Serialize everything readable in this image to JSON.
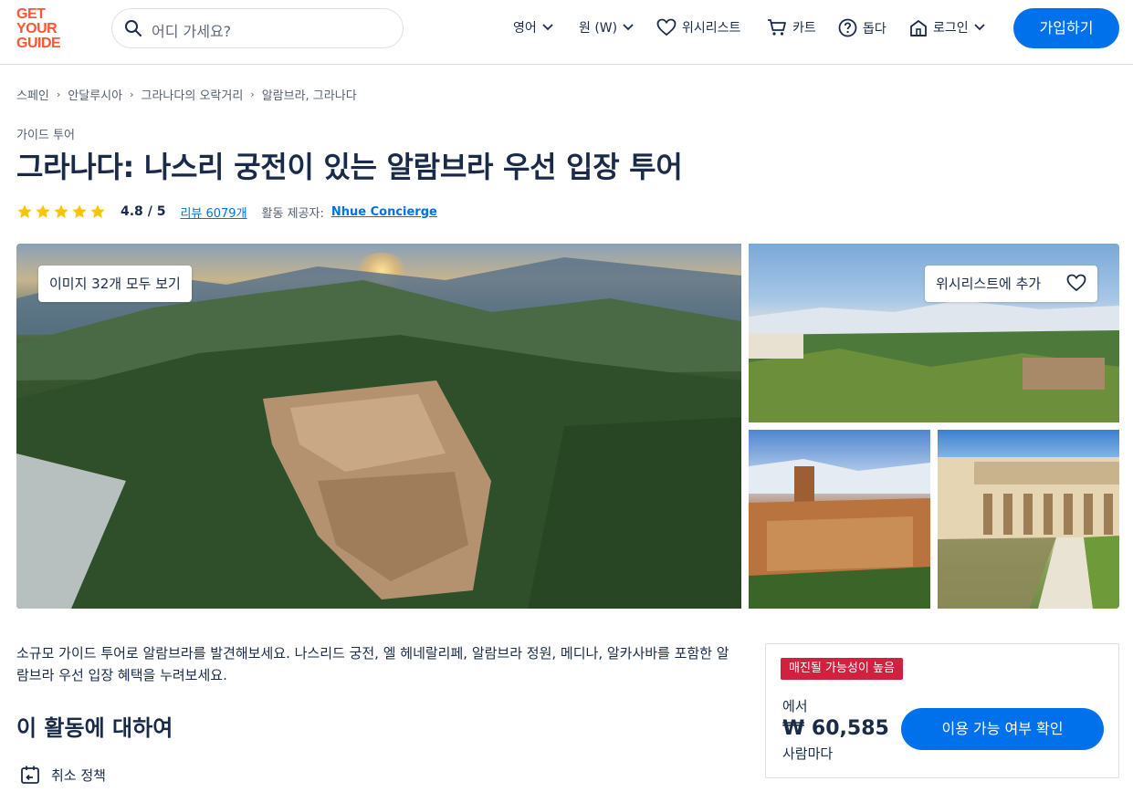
{
  "header": {
    "logo": [
      "GET",
      "YOUR",
      "GUIDE"
    ],
    "search_placeholder": "어디 가세요?",
    "language": "영어",
    "currency": "원 (W)",
    "wishlist": "위시리스트",
    "cart": "카트",
    "help": "돕다",
    "login": "로그인",
    "signup": "가입하기",
    "brand_color": "#ff5533",
    "accent_color": "#0071eb"
  },
  "breadcrumb": [
    "스페인",
    "안달루시아",
    "그라나다의 오락거리",
    "알람브라, 그라나다"
  ],
  "activity": {
    "category": "가이드 투어",
    "title": "그라나다: 나스리 궁전이 있는 알람브라 우선 입장 투어",
    "rating": "4.8",
    "rating_max": "5",
    "rating_sep": "/",
    "star_count": 5,
    "reviews": "리뷰 6079개",
    "provider_label": "활동 제공자:",
    "provider": "Nhue Concierge"
  },
  "gallery": {
    "view_all": "이미지 32개 모두 보기",
    "add_wishlist": "위시리스트에 추가"
  },
  "content": {
    "summary": "소규모 가이드 투어로 알람브라를 발견해보세요. 나스리드 궁전, 엘 헤네랄리페, 알람브라 정원, 메디나, 알카사바를 포함한 알람브라 우선 입장 혜택을 누려보세요.",
    "about_heading": "이 활동에 대하여",
    "cancel_policy": "취소 정책"
  },
  "booking": {
    "badge": "매진될 가능성이 높음",
    "from": "에서",
    "price": "₩ 60,585",
    "per": "사람마다",
    "check_button": "이용 가능 여부 확인",
    "badge_color": "#d0223f"
  }
}
